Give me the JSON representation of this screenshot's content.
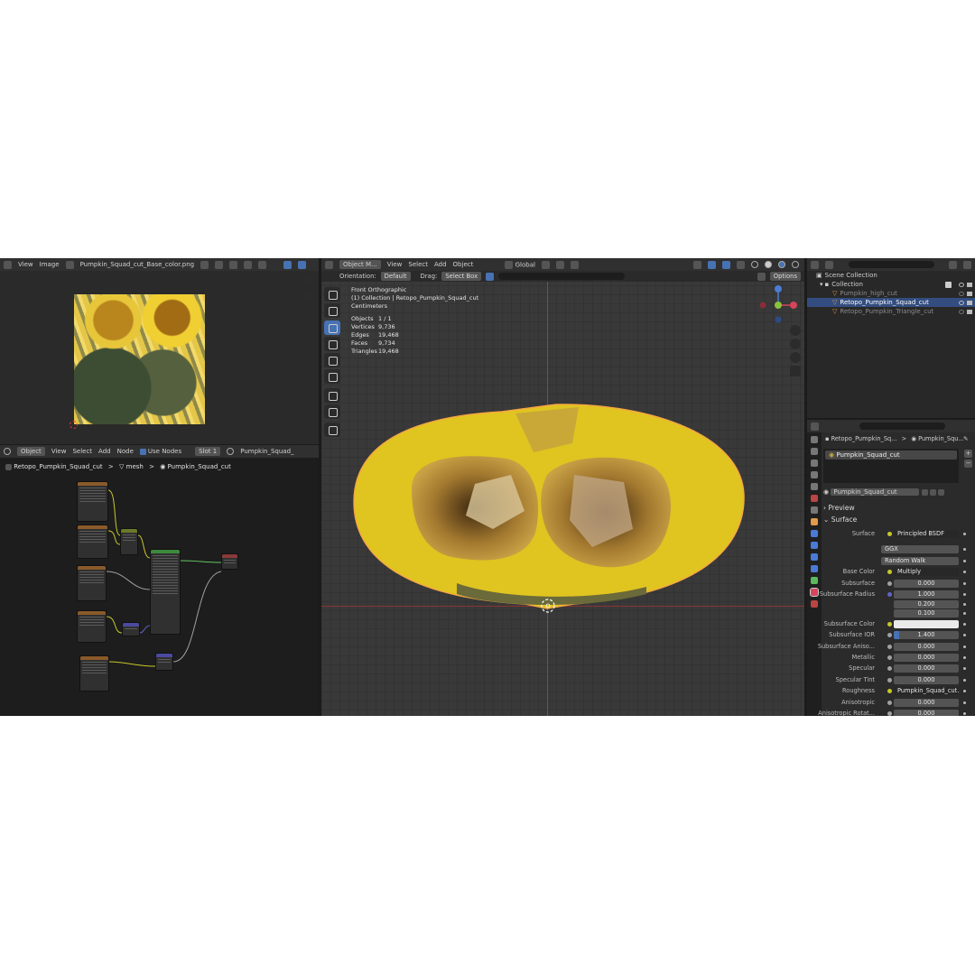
{
  "image_editor": {
    "menu": [
      "View",
      "Image"
    ],
    "image_name": "Pumpkin_Squad_cut_Base_color.png"
  },
  "node_editor": {
    "mode": "Object",
    "menu": [
      "View",
      "Select",
      "Add",
      "Node"
    ],
    "use_nodes": "Use Nodes",
    "slot": "Slot 1",
    "material": "Pumpkin_Squad_",
    "breadcrumb": [
      "Retopo_Pumpkin_Squad_cut",
      "mesh",
      "Pumpkin_Squad_cut"
    ]
  },
  "viewport": {
    "mode": "Object M...",
    "menu": [
      "View",
      "Select",
      "Add",
      "Object"
    ],
    "transform": "Global",
    "orientation_label": "Orientation:",
    "orientation_value": "Default",
    "drag_label": "Drag:",
    "drag_value": "Select Box",
    "options": "Options",
    "view_name": "Front Orthographic",
    "collection_info": "(1) Collection | Retopo_Pumpkin_Squad_cut",
    "units": "Centimeters",
    "stats": [
      {
        "label": "Objects",
        "value": "1 / 1"
      },
      {
        "label": "Vertices",
        "value": "9,736"
      },
      {
        "label": "Edges",
        "value": "19,468"
      },
      {
        "label": "Faces",
        "value": "9,734"
      },
      {
        "label": "Triangles",
        "value": "19,468"
      }
    ]
  },
  "outliner": {
    "scene": "Scene Collection",
    "collection": "Collection",
    "items": [
      {
        "name": "Pumpkin_high_cut",
        "selected": false
      },
      {
        "name": "Retopo_Pumpkin_Squad_cut",
        "selected": true
      },
      {
        "name": "Retopo_Pumpkin_Triangle_cut",
        "selected": false
      }
    ]
  },
  "properties": {
    "breadcrumb_object": "Retopo_Pumpkin_Sq...",
    "breadcrumb_material": "Pumpkin_Squ...",
    "slot_item": "Pumpkin_Squad_cut",
    "material_name": "Pumpkin_Squad_cut",
    "preview": "Preview",
    "surface": "Surface",
    "rows": [
      {
        "label": "Surface",
        "value": "Principled BSDF",
        "kind": "dark"
      },
      {
        "label": "",
        "value": "GGX",
        "kind": "left"
      },
      {
        "label": "",
        "value": "Random Walk",
        "kind": "left"
      },
      {
        "label": "Base Color",
        "value": "Multiply",
        "kind": "dark"
      },
      {
        "label": "Subsurface",
        "value": "0.000"
      },
      {
        "label": "Subsurface Radius",
        "value": "1.000"
      },
      {
        "label": "",
        "value": "0.200"
      },
      {
        "label": "",
        "value": "0.100"
      },
      {
        "label": "Subsurface Color",
        "value": "",
        "kind": "white"
      },
      {
        "label": "Subsurface IOR",
        "value": "1.400",
        "kind": "bar"
      },
      {
        "label": "Subsurface Aniso...",
        "value": "0.000"
      },
      {
        "label": "Metallic",
        "value": "0.000"
      },
      {
        "label": "Specular",
        "value": "0.000"
      },
      {
        "label": "Specular Tint",
        "value": "0.000"
      },
      {
        "label": "Roughness",
        "value": "Pumpkin_Squad_cut...",
        "kind": "dark"
      },
      {
        "label": "Anisotropic",
        "value": "0.000"
      },
      {
        "label": "Anisotropic Rotat...",
        "value": "0.000"
      }
    ]
  },
  "colors": {
    "accent": "#4772b3",
    "header": "#303030",
    "pumpkin_flesh": "#e0c420",
    "selection_outline": "#f5a742"
  }
}
